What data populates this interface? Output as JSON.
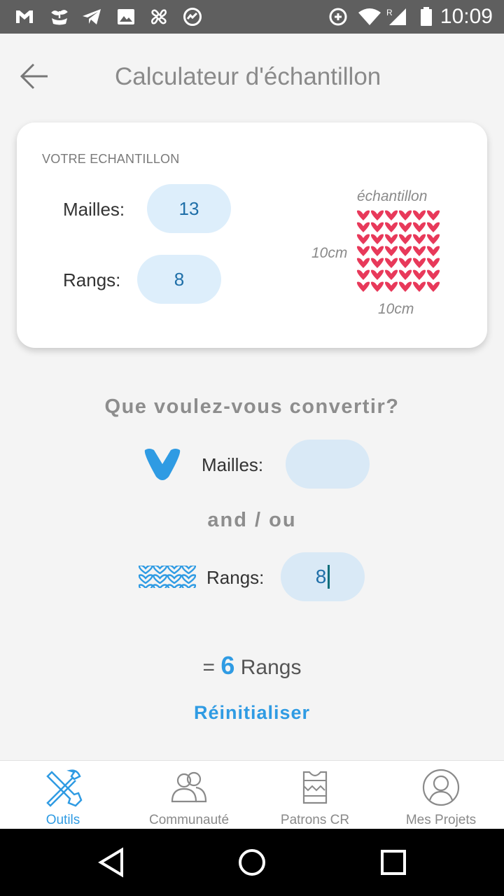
{
  "status_bar": {
    "time": "10:09",
    "left_icons": [
      "gmail-icon",
      "plant-icon",
      "telegram-icon",
      "image-icon",
      "pinwheel-icon",
      "activity-icon"
    ],
    "right_icons": [
      "data-saver-icon",
      "wifi-icon",
      "signal-icon",
      "battery-icon"
    ],
    "signal_label": "R"
  },
  "appbar": {
    "title": "Calculateur d'échantillon"
  },
  "card": {
    "label": "VOTRE ECHANTILLON",
    "mailles_label": "Mailles:",
    "mailles_value": "13",
    "rangs_label": "Rangs:",
    "rangs_value": "8",
    "swatch_top": "échantillon",
    "swatch_side": "10cm",
    "swatch_bottom": "10cm"
  },
  "converter": {
    "question": "Que voulez-vous convertir?",
    "mailles_label": "Mailles:",
    "mailles_value": "",
    "and_or": "and / ou",
    "rangs_label": "Rangs:",
    "rangs_value": "8"
  },
  "result": {
    "prefix": "=",
    "value": "6",
    "unit": "Rangs"
  },
  "reset_label": "Réinitialiser",
  "bottom_nav": [
    {
      "label": "Outils",
      "icon": "tools-icon",
      "active": true
    },
    {
      "label": "Communauté",
      "icon": "community-icon",
      "active": false
    },
    {
      "label": "Patrons CR",
      "icon": "sweater-icon",
      "active": false
    },
    {
      "label": "Mes Projets",
      "icon": "profile-icon",
      "active": false
    }
  ],
  "colors": {
    "accent": "#2f9be3",
    "pill": "#ddeefb",
    "swatch": "#e8395a"
  }
}
